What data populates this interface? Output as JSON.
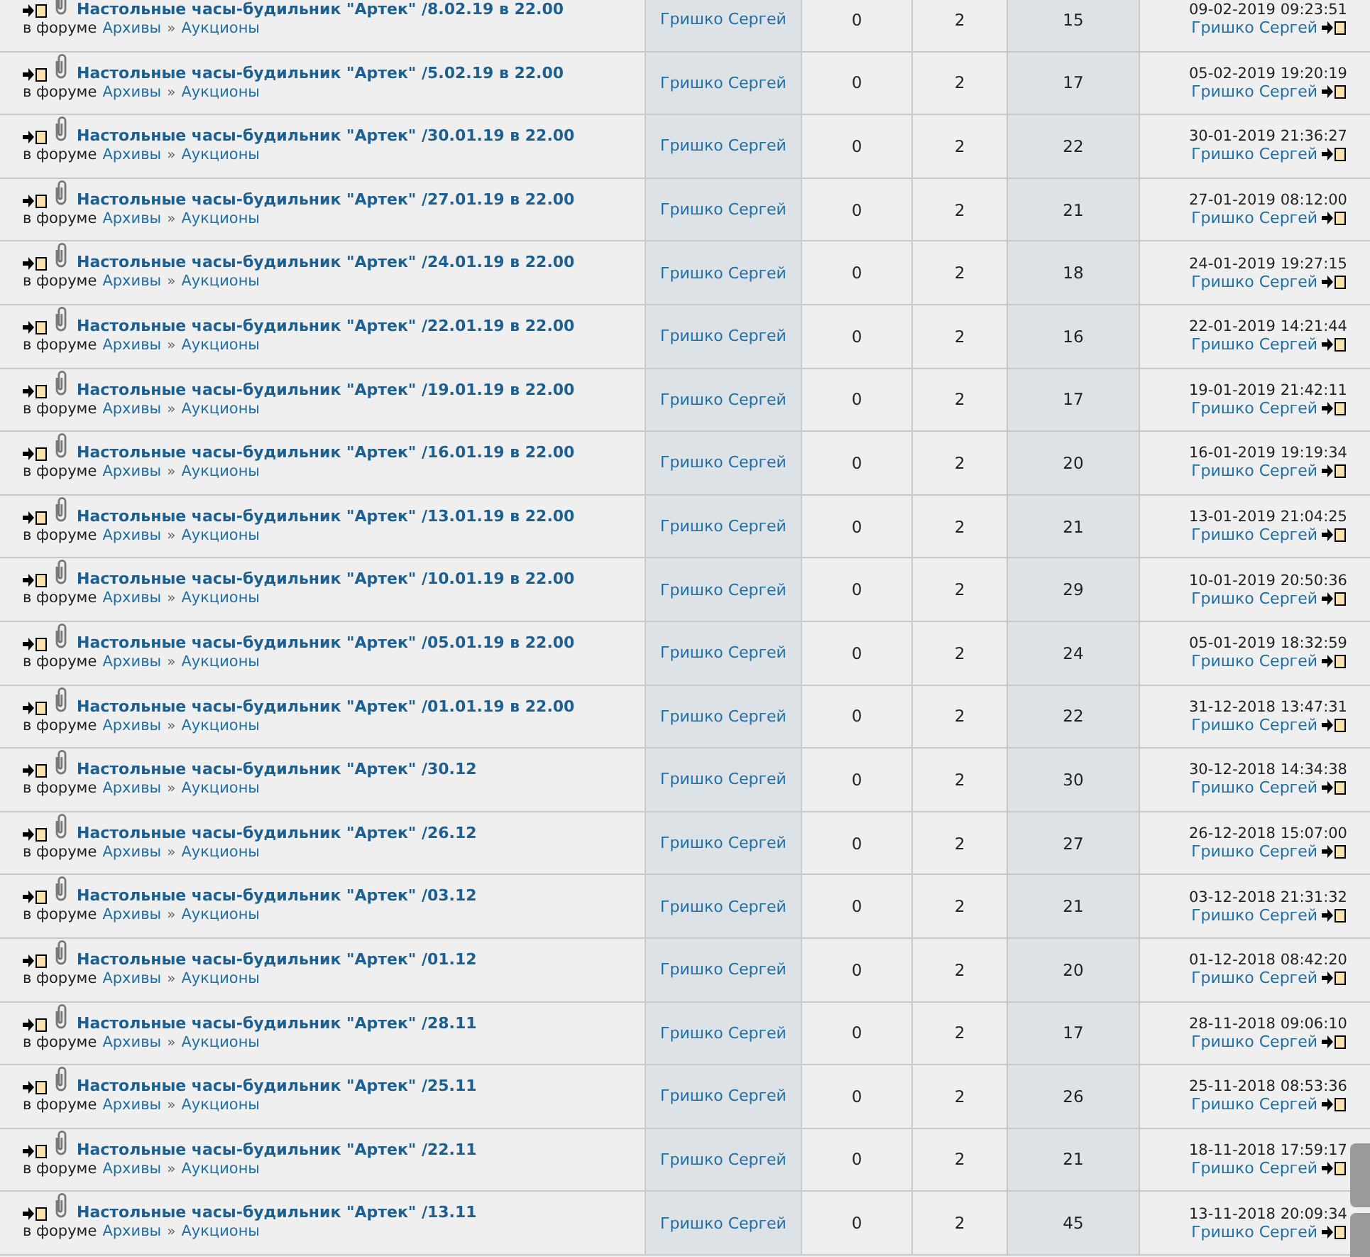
{
  "topics": [
    {
      "title": "Настольные часы-будильник \"Артек\" /8.02.19 в 22.00",
      "forum_label": "в форуме",
      "forum": "Архивы",
      "separator": "»",
      "subforum": "Аукционы",
      "author": "Гришко Сергей",
      "replies": "0",
      "column_4": "2",
      "views": "15",
      "last_date": "09-02-2019 09:23:51",
      "last_author": "Гришко Сергей"
    },
    {
      "title": "Настольные часы-будильник \"Артек\" /5.02.19 в 22.00",
      "forum_label": "в форуме",
      "forum": "Архивы",
      "separator": "»",
      "subforum": "Аукционы",
      "author": "Гришко Сергей",
      "replies": "0",
      "column_4": "2",
      "views": "17",
      "last_date": "05-02-2019 19:20:19",
      "last_author": "Гришко Сергей"
    },
    {
      "title": "Настольные часы-будильник \"Артек\" /30.01.19 в 22.00",
      "forum_label": "в форуме",
      "forum": "Архивы",
      "separator": "»",
      "subforum": "Аукционы",
      "author": "Гришко Сергей",
      "replies": "0",
      "column_4": "2",
      "views": "22",
      "last_date": "30-01-2019 21:36:27",
      "last_author": "Гришко Сергей"
    },
    {
      "title": "Настольные часы-будильник \"Артек\" /27.01.19 в 22.00",
      "forum_label": "в форуме",
      "forum": "Архивы",
      "separator": "»",
      "subforum": "Аукционы",
      "author": "Гришко Сергей",
      "replies": "0",
      "column_4": "2",
      "views": "21",
      "last_date": "27-01-2019 08:12:00",
      "last_author": "Гришко Сергей"
    },
    {
      "title": "Настольные часы-будильник \"Артек\" /24.01.19 в 22.00",
      "forum_label": "в форуме",
      "forum": "Архивы",
      "separator": "»",
      "subforum": "Аукционы",
      "author": "Гришко Сергей",
      "replies": "0",
      "column_4": "2",
      "views": "18",
      "last_date": "24-01-2019 19:27:15",
      "last_author": "Гришко Сергей"
    },
    {
      "title": "Настольные часы-будильник \"Артек\" /22.01.19 в 22.00",
      "forum_label": "в форуме",
      "forum": "Архивы",
      "separator": "»",
      "subforum": "Аукционы",
      "author": "Гришко Сергей",
      "replies": "0",
      "column_4": "2",
      "views": "16",
      "last_date": "22-01-2019 14:21:44",
      "last_author": "Гришко Сергей"
    },
    {
      "title": "Настольные часы-будильник \"Артек\" /19.01.19 в 22.00",
      "forum_label": "в форуме",
      "forum": "Архивы",
      "separator": "»",
      "subforum": "Аукционы",
      "author": "Гришко Сергей",
      "replies": "0",
      "column_4": "2",
      "views": "17",
      "last_date": "19-01-2019 21:42:11",
      "last_author": "Гришко Сергей"
    },
    {
      "title": "Настольные часы-будильник \"Артек\" /16.01.19 в 22.00",
      "forum_label": "в форуме",
      "forum": "Архивы",
      "separator": "»",
      "subforum": "Аукционы",
      "author": "Гришко Сергей",
      "replies": "0",
      "column_4": "2",
      "views": "20",
      "last_date": "16-01-2019 19:19:34",
      "last_author": "Гришко Сергей"
    },
    {
      "title": "Настольные часы-будильник \"Артек\" /13.01.19 в 22.00",
      "forum_label": "в форуме",
      "forum": "Архивы",
      "separator": "»",
      "subforum": "Аукционы",
      "author": "Гришко Сергей",
      "replies": "0",
      "column_4": "2",
      "views": "21",
      "last_date": "13-01-2019 21:04:25",
      "last_author": "Гришко Сергей"
    },
    {
      "title": "Настольные часы-будильник \"Артек\" /10.01.19 в 22.00",
      "forum_label": "в форуме",
      "forum": "Архивы",
      "separator": "»",
      "subforum": "Аукционы",
      "author": "Гришко Сергей",
      "replies": "0",
      "column_4": "2",
      "views": "29",
      "last_date": "10-01-2019 20:50:36",
      "last_author": "Гришко Сергей"
    },
    {
      "title": "Настольные часы-будильник \"Артек\" /05.01.19 в 22.00",
      "forum_label": "в форуме",
      "forum": "Архивы",
      "separator": "»",
      "subforum": "Аукционы",
      "author": "Гришко Сергей",
      "replies": "0",
      "column_4": "2",
      "views": "24",
      "last_date": "05-01-2019 18:32:59",
      "last_author": "Гришко Сергей"
    },
    {
      "title": "Настольные часы-будильник \"Артек\" /01.01.19 в 22.00",
      "forum_label": "в форуме",
      "forum": "Архивы",
      "separator": "»",
      "subforum": "Аукционы",
      "author": "Гришко Сергей",
      "replies": "0",
      "column_4": "2",
      "views": "22",
      "last_date": "31-12-2018 13:47:31",
      "last_author": "Гришко Сергей"
    },
    {
      "title": "Настольные часы-будильник \"Артек\" /30.12",
      "forum_label": "в форуме",
      "forum": "Архивы",
      "separator": "»",
      "subforum": "Аукционы",
      "author": "Гришко Сергей",
      "replies": "0",
      "column_4": "2",
      "views": "30",
      "last_date": "30-12-2018 14:34:38",
      "last_author": "Гришко Сергей"
    },
    {
      "title": "Настольные часы-будильник \"Артек\" /26.12",
      "forum_label": "в форуме",
      "forum": "Архивы",
      "separator": "»",
      "subforum": "Аукционы",
      "author": "Гришко Сергей",
      "replies": "0",
      "column_4": "2",
      "views": "27",
      "last_date": "26-12-2018 15:07:00",
      "last_author": "Гришко Сергей"
    },
    {
      "title": "Настольные часы-будильник \"Артек\" /03.12",
      "forum_label": "в форуме",
      "forum": "Архивы",
      "separator": "»",
      "subforum": "Аукционы",
      "author": "Гришко Сергей",
      "replies": "0",
      "column_4": "2",
      "views": "21",
      "last_date": "03-12-2018 21:31:32",
      "last_author": "Гришко Сергей"
    },
    {
      "title": "Настольные часы-будильник \"Артек\" /01.12",
      "forum_label": "в форуме",
      "forum": "Архивы",
      "separator": "»",
      "subforum": "Аукционы",
      "author": "Гришко Сергей",
      "replies": "0",
      "column_4": "2",
      "views": "20",
      "last_date": "01-12-2018 08:42:20",
      "last_author": "Гришко Сергей"
    },
    {
      "title": "Настольные часы-будильник \"Артек\" /28.11",
      "forum_label": "в форуме",
      "forum": "Архивы",
      "separator": "»",
      "subforum": "Аукционы",
      "author": "Гришко Сергей",
      "replies": "0",
      "column_4": "2",
      "views": "17",
      "last_date": "28-11-2018 09:06:10",
      "last_author": "Гришко Сергей"
    },
    {
      "title": "Настольные часы-будильник \"Артек\" /25.11",
      "forum_label": "в форуме",
      "forum": "Архивы",
      "separator": "»",
      "subforum": "Аукционы",
      "author": "Гришко Сергей",
      "replies": "0",
      "column_4": "2",
      "views": "26",
      "last_date": "25-11-2018 08:53:36",
      "last_author": "Гришко Сергей"
    },
    {
      "title": "Настольные часы-будильник \"Артек\" /22.11",
      "forum_label": "в форуме",
      "forum": "Архивы",
      "separator": "»",
      "subforum": "Аукционы",
      "author": "Гришко Сергей",
      "replies": "0",
      "column_4": "2",
      "views": "21",
      "last_date": "18-11-2018 17:59:17",
      "last_author": "Гришко Сергей"
    },
    {
      "title": "Настольные часы-будильник \"Артек\" /13.11",
      "forum_label": "в форуме",
      "forum": "Архивы",
      "separator": "»",
      "subforum": "Аукционы",
      "author": "Гришко Сергей",
      "replies": "0",
      "column_4": "2",
      "views": "45",
      "last_date": "13-11-2018 20:09:34",
      "last_author": "Гришко Сергей"
    }
  ]
}
